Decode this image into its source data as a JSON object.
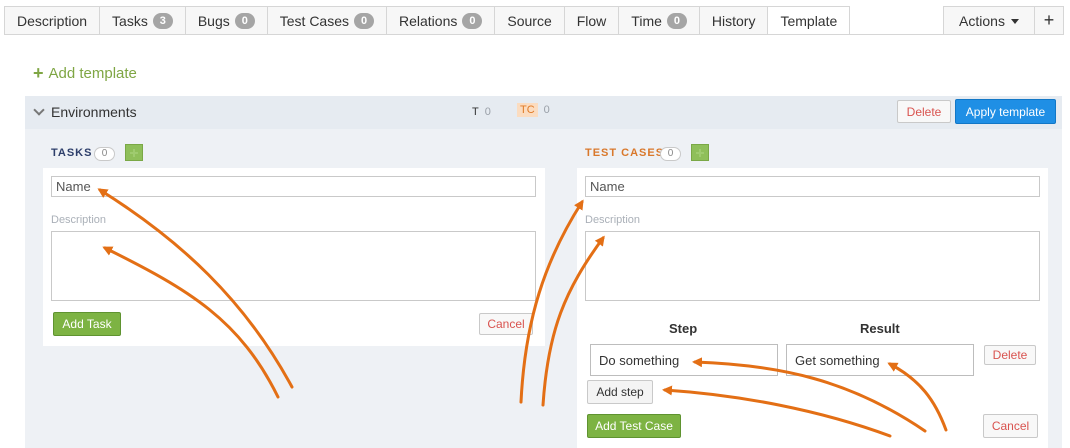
{
  "tabs": [
    {
      "label": "Description",
      "badge": null
    },
    {
      "label": "Tasks",
      "badge": "3"
    },
    {
      "label": "Bugs",
      "badge": "0"
    },
    {
      "label": "Test Cases",
      "badge": "0"
    },
    {
      "label": "Relations",
      "badge": "0"
    },
    {
      "label": "Source",
      "badge": null
    },
    {
      "label": "Flow",
      "badge": null
    },
    {
      "label": "Time",
      "badge": "0"
    },
    {
      "label": "History",
      "badge": null
    },
    {
      "label": "Template",
      "badge": null,
      "active": true
    }
  ],
  "toolbar": {
    "actions_label": "Actions",
    "plus_label": "+"
  },
  "add_template_label": "Add template",
  "section": {
    "title": "Environments",
    "task_tag": "T",
    "task_count": "0",
    "tc_tag": "TC",
    "tc_count": "0",
    "delete_label": "Delete",
    "apply_label": "Apply template"
  },
  "tasks_panel": {
    "label": "TASKS",
    "count": "0",
    "name_value": "Name",
    "description_label": "Description",
    "add_label": "Add Task",
    "cancel_label": "Cancel"
  },
  "tc_panel": {
    "label": "TEST CASES",
    "count": "0",
    "name_value": "Name",
    "description_label": "Description",
    "step_header": "Step",
    "result_header": "Result",
    "step_value": "Do something",
    "result_value": "Get something",
    "delete_label": "Delete",
    "add_step_label": "Add step",
    "add_label": "Add Test Case",
    "cancel_label": "Cancel"
  },
  "colors": {
    "accent_green": "#7db343",
    "accent_blue": "#1f8fe5",
    "annotation_orange": "#e36f15",
    "tc_orange": "#d9782b"
  }
}
